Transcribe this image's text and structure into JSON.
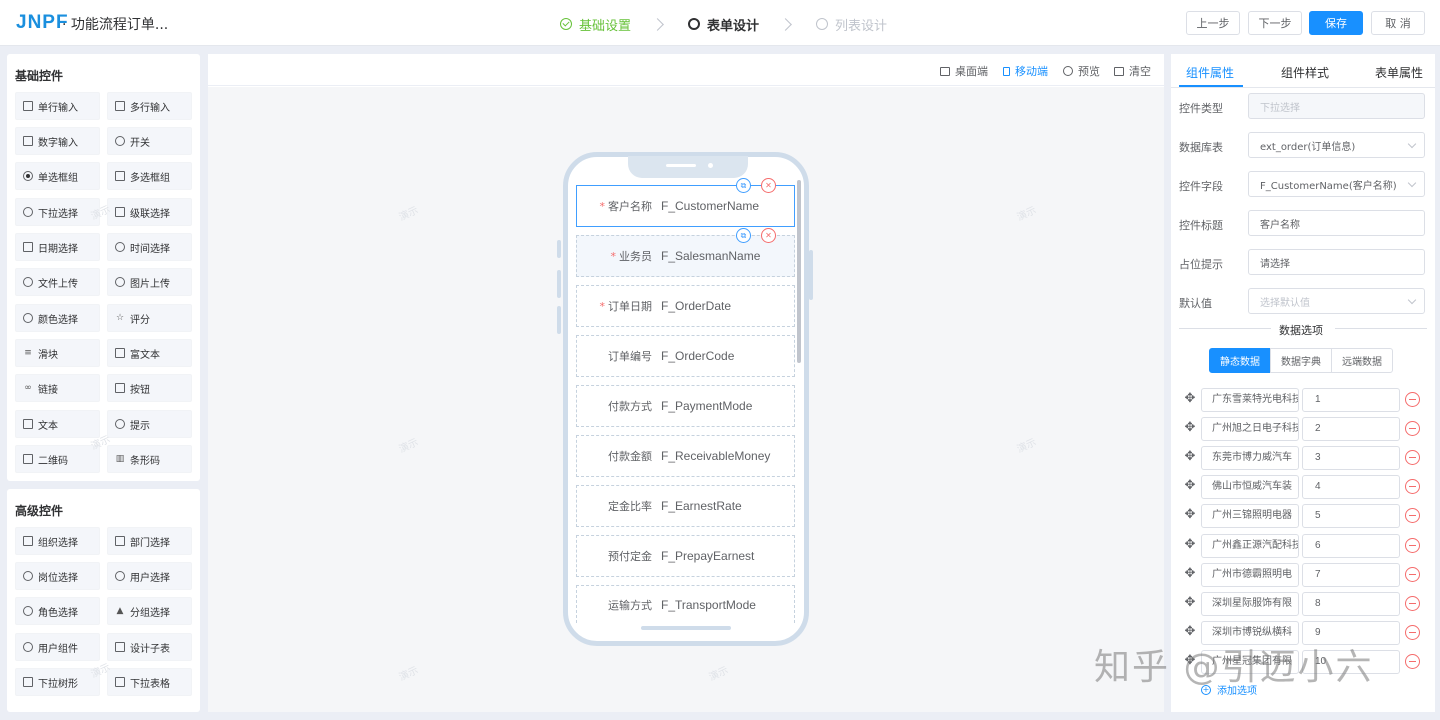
{
  "header": {
    "logo": "JNPF",
    "title": "· 功能流程订单...",
    "steps": [
      {
        "label": "基础设置",
        "state": "done"
      },
      {
        "label": "表单设计",
        "state": "active"
      },
      {
        "label": "列表设计",
        "state": "pending"
      }
    ],
    "buttons": {
      "prev": "上一步",
      "next": "下一步",
      "save": "保存",
      "cancel": "取 消"
    }
  },
  "basic_controls": {
    "title": "基础控件",
    "items": [
      "单行输入",
      "多行输入",
      "数字输入",
      "开关",
      "单选框组",
      "多选框组",
      "下拉选择",
      "级联选择",
      "日期选择",
      "时间选择",
      "文件上传",
      "图片上传",
      "颜色选择",
      "评分",
      "滑块",
      "富文本",
      "链接",
      "按钮",
      "文本",
      "提示",
      "二维码",
      "条形码"
    ]
  },
  "advanced_controls": {
    "title": "高级控件",
    "items": [
      "组织选择",
      "部门选择",
      "岗位选择",
      "用户选择",
      "角色选择",
      "分组选择",
      "用户组件",
      "设计子表",
      "下拉树形",
      "下拉表格"
    ]
  },
  "canvas_toolbar": {
    "desktop": "桌面端",
    "mobile": "移动端",
    "preview": "预览",
    "clear": "清空"
  },
  "watermark": "演示",
  "fields": [
    {
      "label": "客户名称",
      "value": "F_CustomerName",
      "required": true
    },
    {
      "label": "业务员",
      "value": "F_SalesmanName",
      "required": true
    },
    {
      "label": "订单日期",
      "value": "F_OrderDate",
      "required": true
    },
    {
      "label": "订单编号",
      "value": "F_OrderCode",
      "required": false
    },
    {
      "label": "付款方式",
      "value": "F_PaymentMode",
      "required": false
    },
    {
      "label": "付款金额",
      "value": "F_ReceivableMoney",
      "required": false
    },
    {
      "label": "定金比率",
      "value": "F_EarnestRate",
      "required": false
    },
    {
      "label": "预付定金",
      "value": "F_PrepayEarnest",
      "required": false
    },
    {
      "label": "运输方式",
      "value": "F_TransportMode",
      "required": false
    }
  ],
  "required_mark": "*",
  "right_panel": {
    "tabs": [
      "组件属性",
      "组件样式",
      "表单属性"
    ],
    "props": [
      {
        "label": "控件类型",
        "value": "下拉选择",
        "kind": "disabled"
      },
      {
        "label": "数据库表",
        "value": "ext_order(订单信息)",
        "kind": "select"
      },
      {
        "label": "控件字段",
        "value": "F_CustomerName(客户名称)",
        "kind": "select"
      },
      {
        "label": "控件标题",
        "value": "客户名称",
        "kind": "input"
      },
      {
        "label": "占位提示",
        "value": "请选择",
        "kind": "input"
      },
      {
        "label": "默认值",
        "value": "选择默认值",
        "kind": "placeholder-select"
      }
    ],
    "section_title": "数据选项",
    "segments": [
      "静态数据",
      "数据字典",
      "远端数据"
    ],
    "options": [
      {
        "name": "广东雪莱特光电科技",
        "value": "1"
      },
      {
        "name": "广州旭之日电子科技",
        "value": "2"
      },
      {
        "name": "东莞市博力威汽车",
        "value": "3"
      },
      {
        "name": "佛山市恒威汽车装",
        "value": "4"
      },
      {
        "name": "广州三锦照明电器",
        "value": "5"
      },
      {
        "name": "广州鑫正源汽配科技",
        "value": "6"
      },
      {
        "name": "广州市德霸照明电",
        "value": "7"
      },
      {
        "name": "深圳星际服饰有限",
        "value": "8"
      },
      {
        "name": "深圳市博锐纵横科",
        "value": "9"
      },
      {
        "name": "广州星冠集团有限",
        "value": "10"
      }
    ],
    "add_option": "添加选项"
  },
  "corner_watermark": "知乎 @引迈小六"
}
